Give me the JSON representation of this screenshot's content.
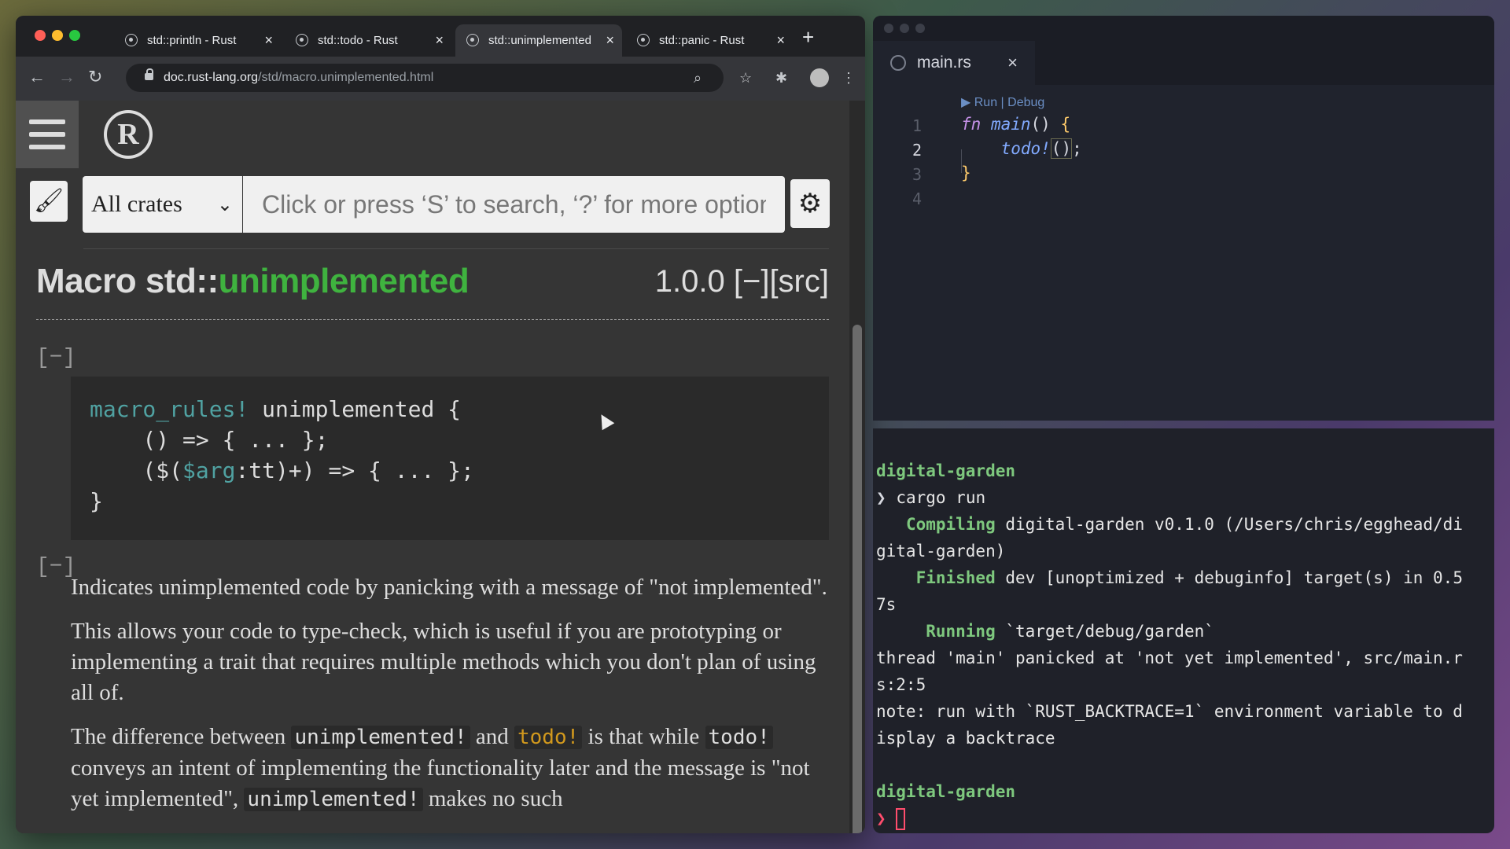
{
  "browser": {
    "tabs": [
      {
        "label": "std::println - Rust"
      },
      {
        "label": "std::todo - Rust"
      },
      {
        "label": "std::unimplemented"
      },
      {
        "label": "std::panic - Rust"
      }
    ],
    "url": {
      "host": "doc.rust-lang.org",
      "path": "/std/macro.unimplemented.html"
    }
  },
  "docs": {
    "logo_letter": "R",
    "crate_select": "All crates",
    "search_placeholder": "Click or press ‘S’ to search, ‘?’ for more options…",
    "title_prefix": "Macro std::",
    "title_name": "unimplemented",
    "version_src": "1.0.0 [−][src]",
    "collapse_toggle": "[−]",
    "code": {
      "l1_kw": "macro_rules!",
      "l1_rest": " unimplemented {",
      "l2": "    () => { ... };",
      "l3_a": "    ($(",
      "l3_var": "$arg",
      "l3_b": ":tt)+) => { ... };",
      "l4": "}"
    },
    "para1": "Indicates unimplemented code by panicking with a message of \"not implemented\".",
    "para2": "This allows your code to type-check, which is useful if you are prototyping or implementing a trait that requires multiple methods which you don't plan of using all of.",
    "para3": {
      "a": "The difference between ",
      "code1": "unimplemented!",
      "b": " and ",
      "code2": "todo!",
      "c": " is that while ",
      "code3": "todo!",
      "d": " conveys an intent of implementing the functionality later and the message is \"not yet implemented\", ",
      "code4": "unimplemented!",
      "e": " makes no such"
    }
  },
  "editor": {
    "tab": "main.rs",
    "codelens": "▶ Run | Debug",
    "lines": [
      "1",
      "2",
      "3",
      "4"
    ],
    "code": {
      "fn_kw": "fn",
      "fn_name": "main",
      "fn_rest": "() ",
      "open_brace": "{",
      "call": "todo!",
      "call_parens": "()",
      "semi": ";",
      "close_brace": "}"
    }
  },
  "terminal": {
    "dir": "digital-garden",
    "cmd": "cargo run",
    "compiling_label": "Compiling",
    "compiling_text": " digital-garden v0.1.0 (/Users/chris/egghead/di",
    "compiling_wrap": "gital-garden)",
    "finished_label": "Finished",
    "finished_text": " dev [unoptimized + debuginfo] target(s) in 0.5",
    "finished_wrap": "7s",
    "running_label": "Running",
    "running_text": " `target/debug/garden`",
    "panic1": "thread 'main' panicked at 'not yet implemented', src/main.r",
    "panic2": "s:2:5",
    "note1": "note: run with `RUST_BACKTRACE=1` environment variable to d",
    "note2": "isplay a backtrace",
    "dir2": "digital-garden",
    "prompt": "❯"
  }
}
